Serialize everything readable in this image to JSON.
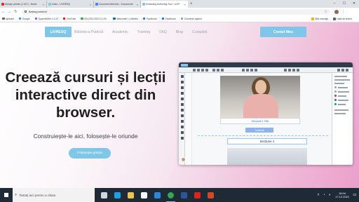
{
  "browser": {
    "tabs": [
      {
        "label": "Mesaje primite (1 627) - iliesbi",
        "favicon_color": "#d93025",
        "active": false
      },
      {
        "label": "Index - LIVRESQ",
        "favicon_color": "#7ec7e8",
        "active": false
      },
      {
        "label": "Document fără titlu - Documente",
        "favicon_color": "#4285f4",
        "active": false
      },
      {
        "label": "eLearning Authoring Tool - LIVR",
        "favicon_color": "#7ec7e8",
        "active": true
      }
    ],
    "new_tab_glyph": "+",
    "window_controls": {
      "minimize": "–",
      "maximize": "☐",
      "close": "✕"
    },
    "address": "livresq.com/ro/",
    "bookmarks": [
      {
        "label": "Aplicații",
        "color": "#5f6368"
      },
      {
        "label": "Google",
        "color": "#4285f4"
      },
      {
        "label": "SquirrelMail 1.4.22",
        "color": "#8b5cf6"
      },
      {
        "label": "YouTube",
        "color": "#ff0000"
      },
      {
        "label": "EB-2013-GEO-CI-03...",
        "color": "#34a853"
      },
      {
        "label": "Welcome! | LinkedIn",
        "color": "#0a66c2"
      },
      {
        "label": "Facebook",
        "color": "#1877f2"
      },
      {
        "label": "Facebook",
        "color": "#1877f2"
      },
      {
        "label": "Conversii agricol",
        "color": "#9ca3af"
      }
    ],
    "bookmarks_right": [
      {
        "label": "Alte marcaje",
        "color": "#f4b400"
      },
      {
        "label": "Listă de lecturi",
        "color": "#5f6368"
      }
    ]
  },
  "site": {
    "logo": "LIVRESQ",
    "nav": [
      "Biblioteca Publică",
      "Academic",
      "Training",
      "FAQ",
      "Blog",
      "Cumpără"
    ],
    "cta": "Contul Meu",
    "headline": "Creează cursuri și lecții interactive direct din browser.",
    "subheadline": "Construiește-le aici, folosește-le oriunde",
    "hero_button": "Folosește gratuit",
    "mock": {
      "caption": "Secțiune 1 Title",
      "continue_label": "Continuă",
      "section_label": "Secțiune 1"
    }
  },
  "taskbar": {
    "search_placeholder": "Tastați aici pentru a căuta",
    "apps": [
      {
        "name": "task-view",
        "color": "#cfd8dc"
      },
      {
        "name": "edge",
        "color": "#1f9ee8"
      },
      {
        "name": "file-explorer",
        "color": "#f2c14e"
      },
      {
        "name": "store",
        "color": "#ffffff"
      },
      {
        "name": "mail",
        "color": "#2b88d8"
      },
      {
        "name": "chrome",
        "color": "#34a853",
        "active": true
      },
      {
        "name": "word",
        "color": "#2b579a"
      },
      {
        "name": "acrobat",
        "color": "#e2231a"
      },
      {
        "name": "powerpoint",
        "color": "#d24726"
      }
    ],
    "time": "16:04",
    "date": "17.12.2021"
  }
}
